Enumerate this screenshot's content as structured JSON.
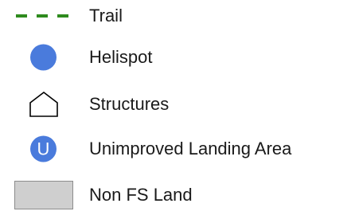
{
  "legend": {
    "items": [
      {
        "label": "Trail",
        "icon": "trail-dashed-line-icon",
        "color": "#2e8b1e"
      },
      {
        "label": "Helispot",
        "icon": "helispot-circle-icon",
        "color": "#4a7bdc"
      },
      {
        "label": "Structures",
        "icon": "structure-house-outline-icon",
        "color": "#000000"
      },
      {
        "label": "Unimproved Landing Area",
        "icon": "unimproved-landing-area-icon",
        "color": "#4a7bdc",
        "glyph": "U"
      },
      {
        "label": "Non FS Land",
        "icon": "non-fs-land-swatch-icon",
        "color": "#cfcfcf"
      }
    ]
  }
}
